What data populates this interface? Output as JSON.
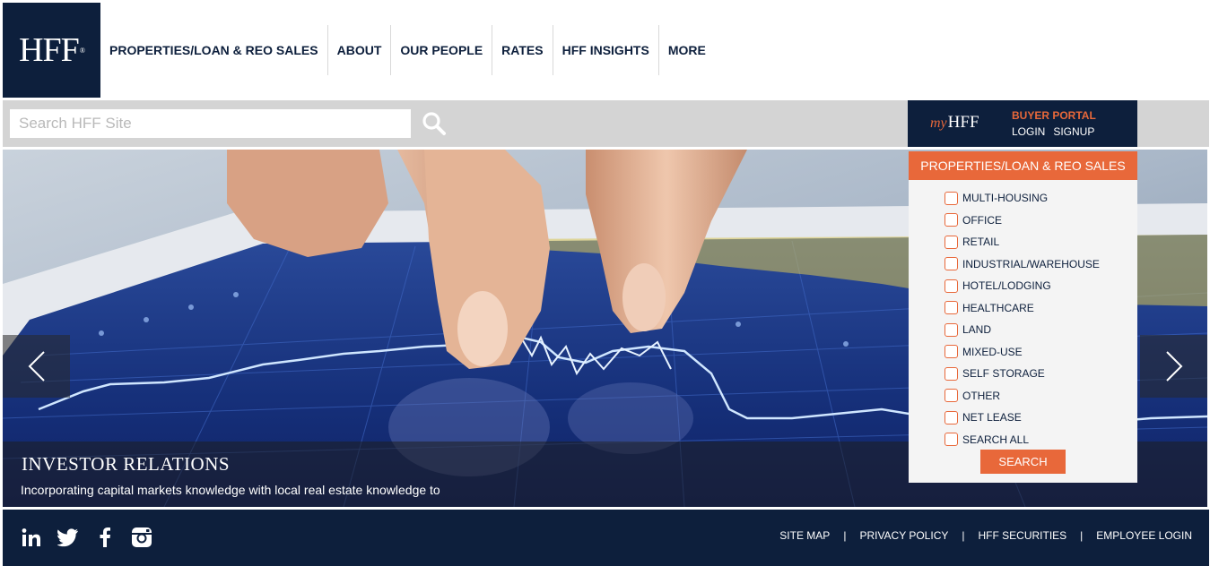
{
  "brand": {
    "logo_text": "HFF",
    "logo_mark": "®"
  },
  "nav": {
    "items": [
      {
        "label": "PROPERTIES/LOAN & REO SALES"
      },
      {
        "label": "ABOUT"
      },
      {
        "label": "OUR PEOPLE"
      },
      {
        "label": "RATES"
      },
      {
        "label": "HFF INSIGHTS"
      },
      {
        "label": "MORE"
      }
    ]
  },
  "search": {
    "placeholder": "Search HFF Site",
    "value": "",
    "icon": "search-icon"
  },
  "myhff": {
    "logo_my": "my",
    "logo_hff": "HFF",
    "portal_title": "BUYER PORTAL",
    "login_label": "LOGIN",
    "signup_label": "SIGNUP"
  },
  "hero": {
    "title": "INVESTOR RELATIONS",
    "text": "Incorporating capital markets knowledge with local real estate knowledge to",
    "prev_icon": "chevron-left-icon",
    "next_icon": "chevron-right-icon"
  },
  "properties": {
    "header": "PROPERTIES/LOAN & REO SALES",
    "items": [
      {
        "label": "MULTI-HOUSING",
        "checked": false
      },
      {
        "label": "OFFICE",
        "checked": false
      },
      {
        "label": "RETAIL",
        "checked": false
      },
      {
        "label": "INDUSTRIAL/WAREHOUSE",
        "checked": false
      },
      {
        "label": "HOTEL/LODGING",
        "checked": false
      },
      {
        "label": "HEALTHCARE",
        "checked": false
      },
      {
        "label": "LAND",
        "checked": false
      },
      {
        "label": "MIXED-USE",
        "checked": false
      },
      {
        "label": "SELF STORAGE",
        "checked": false
      },
      {
        "label": "OTHER",
        "checked": false
      },
      {
        "label": "NET LEASE",
        "checked": false
      },
      {
        "label": "SEARCH ALL",
        "checked": false
      }
    ],
    "search_label": "SEARCH"
  },
  "footer": {
    "social": [
      "linkedin-icon",
      "twitter-icon",
      "facebook-icon",
      "instagram-icon"
    ],
    "links": [
      {
        "label": "SITE MAP"
      },
      {
        "label": "PRIVACY POLICY"
      },
      {
        "label": "HFF SECURITIES"
      },
      {
        "label": "EMPLOYEE LOGIN"
      }
    ],
    "separator": "|"
  },
  "colors": {
    "navy": "#0d1f3c",
    "orange": "#e8683a",
    "gray": "#d4d4d4"
  }
}
